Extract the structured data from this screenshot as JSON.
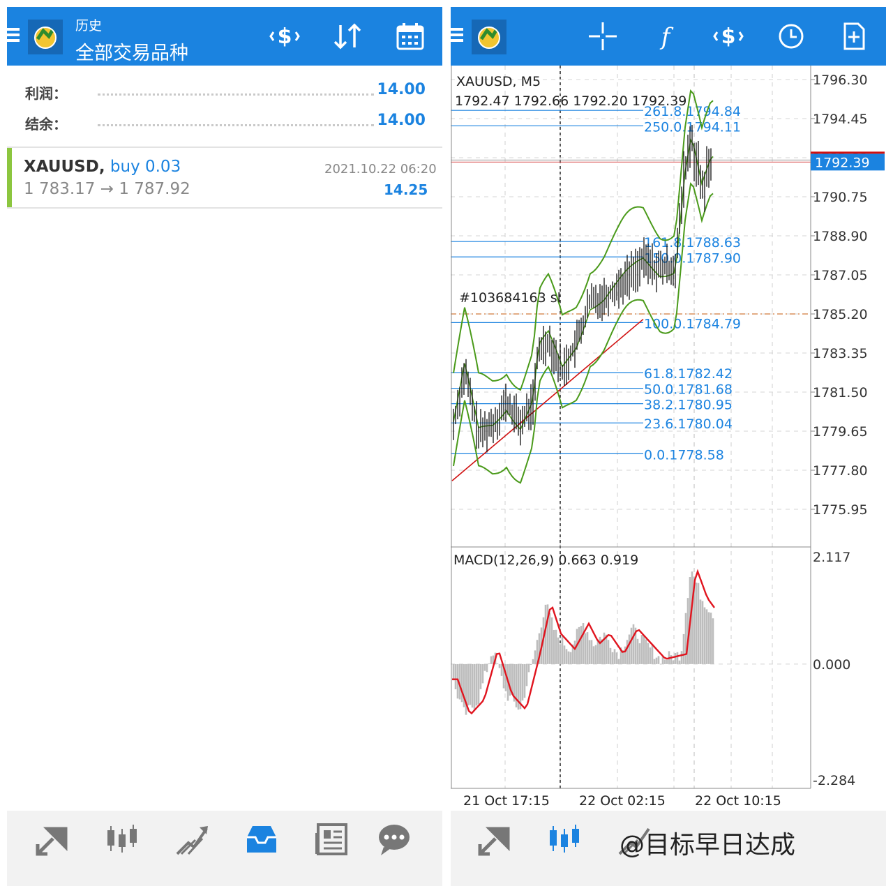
{
  "left_header": {
    "title": "历史",
    "subtitle": "全部交易品种"
  },
  "summary": {
    "profit_label": "利润：",
    "profit_value": "14.00",
    "balance_label": "结余：",
    "balance_value": "14.00"
  },
  "trade": {
    "symbol": "XAUUSD,",
    "side": "buy 0.03",
    "datetime": "2021.10.22 06:20",
    "prices": "1 783.17 → 1 787.92",
    "profit": "14.25"
  },
  "chart": {
    "symbol_tf": "XAUUSD, M5",
    "ohlc": "1792.47 1792.66 1792.20 1792.39",
    "current_price": "1792.39",
    "sl_label": "#103684163 sl",
    "price_ticks": [
      "1796.30",
      "1794.45",
      "1792.60",
      "1790.75",
      "1788.90",
      "1787.05",
      "1785.20",
      "1783.35",
      "1781.50",
      "1779.65",
      "1777.80",
      "1775.95"
    ],
    "fib_levels": [
      {
        "label": "261.8.1794.84",
        "price": 1794.84
      },
      {
        "label": "250.0.1794.11",
        "price": 1794.11
      },
      {
        "label": "161.8.1788.63",
        "price": 1788.63
      },
      {
        "label": "150.0.1787.90",
        "price": 1787.9
      },
      {
        "label": "100.0.1784.79",
        "price": 1784.79
      },
      {
        "label": "61.8.1782.42",
        "price": 1782.42
      },
      {
        "label": "50.0.1781.68",
        "price": 1781.68
      },
      {
        "label": "38.2.1780.95",
        "price": 1780.95
      },
      {
        "label": "23.6.1780.04",
        "price": 1780.04
      },
      {
        "label": "0.0.1778.58",
        "price": 1778.58
      }
    ],
    "sl_price": 1785.2,
    "time_labels": [
      "21 Oct 17:15",
      "22 Oct 02:15",
      "22 Oct 10:15"
    ],
    "macd_label": "MACD(12,26,9) 0.663 0.919",
    "macd_ticks": [
      "2.117",
      "0.000",
      "-2.284"
    ],
    "colors": {
      "price_up": "#000000",
      "bands": "#4a9a1a",
      "signal": "#e0141e",
      "fib": "#1b83e0",
      "hist": "#bdbdbd"
    }
  },
  "nav_left": [
    "trade-icon",
    "quotes-icon",
    "chart-icon",
    "history-icon",
    "news-icon",
    "chat-icon"
  ],
  "nav_right": [
    "trade-icon",
    "quotes-icon",
    "chart-icon"
  ],
  "watermark": "@目标早日达成"
}
